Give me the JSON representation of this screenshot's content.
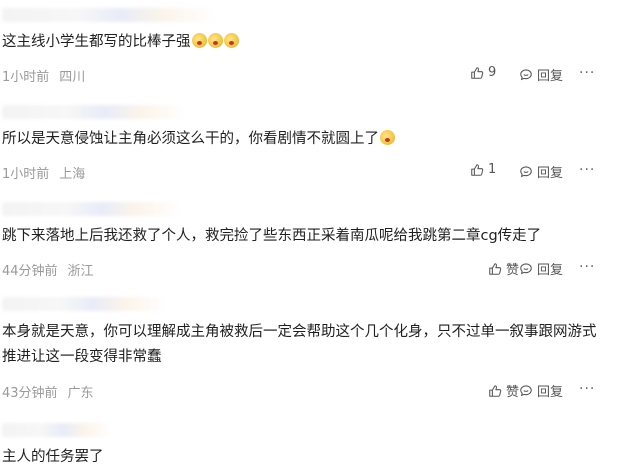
{
  "comments": [
    {
      "text": "这主线小学生都写的比棒子强",
      "emoji_count": 3,
      "time": "1小时前",
      "location": "四川",
      "like": "9",
      "reply_label": "回复"
    },
    {
      "text": "所以是天意侵蚀让主角必须这么干的，你看剧情不就圆上了",
      "emoji_count": 1,
      "time": "1小时前",
      "location": "上海",
      "like": "1",
      "reply_label": "回复"
    },
    {
      "text": "跳下来落地上后我还救了个人，救完捡了些东西正采着南瓜呢给我跳第二章cg传走了",
      "emoji_count": 0,
      "time": "44分钟前",
      "location": "浙江",
      "like": "赞",
      "reply_label": "回复"
    },
    {
      "text": "本身就是天意，你可以理解成主角被救后一定会帮助这个几个化身，只不过单一叙事跟网游式推进让这一段变得非常蠢",
      "emoji_count": 0,
      "time": "43分钟前",
      "location": "广东",
      "like": "赞",
      "reply_label": "回复"
    },
    {
      "text": "主人的任务罢了",
      "emoji_count": 0
    }
  ],
  "more_label": "···"
}
